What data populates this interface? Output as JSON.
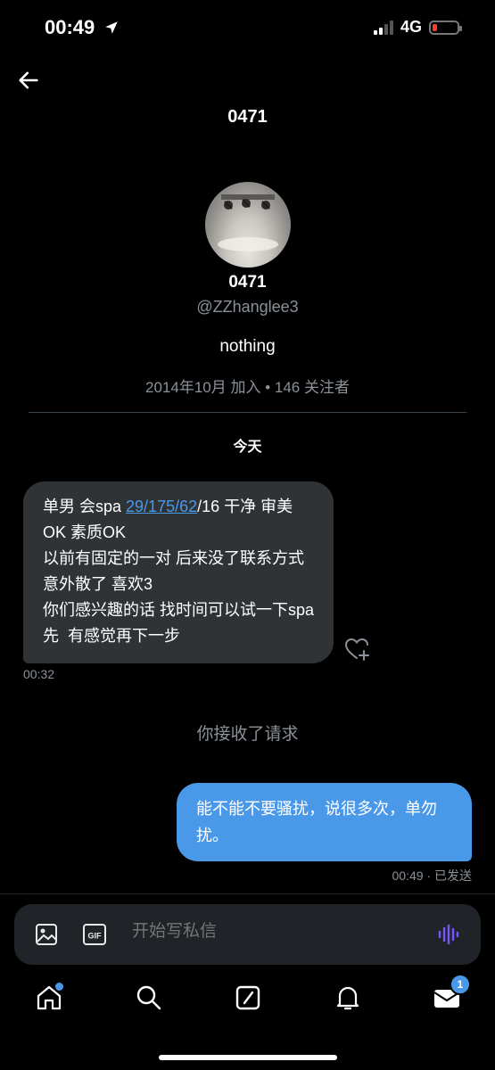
{
  "status_bar": {
    "time": "00:49",
    "network": "4G",
    "battery_level": 0.1,
    "battery_color": "#ff3b30"
  },
  "header": {
    "title": "0471",
    "back_icon": "arrow-left-icon"
  },
  "profile": {
    "name": "0471",
    "handle": "@ZZhanglee3",
    "bio": "nothing",
    "meta": "2014年10月 加入 • 146 关注者"
  },
  "conversation": {
    "date_divider": "今天",
    "incoming": {
      "segments": [
        {
          "text": "单男 会spa "
        },
        {
          "text": "29/175/62",
          "link": true
        },
        {
          "text": "/16 干净 审美OK 素质OK\n以前有固定的一对 后来没了联系方式意外散了 喜欢3\n你们感兴趣的话 找时间可以试一下spa先  有感觉再下一步"
        }
      ],
      "time": "00:32"
    },
    "system_notice": "你接收了请求",
    "outgoing": {
      "text": "能不能不要骚扰，说很多次，单勿扰。",
      "meta": "00:49 · 已发送"
    }
  },
  "composer": {
    "placeholder": "开始写私信",
    "image_icon": "image-icon",
    "gif_icon": "gif-icon",
    "voice_icon": "voice-wave-icon"
  },
  "tabbar": {
    "items": [
      "home-icon",
      "search-icon",
      "compose-icon",
      "bell-icon",
      "mail-icon"
    ],
    "mail_badge": "1"
  },
  "colors": {
    "accent": "#4a99e9",
    "bubble_in": "#2f3336",
    "background": "#000000"
  }
}
